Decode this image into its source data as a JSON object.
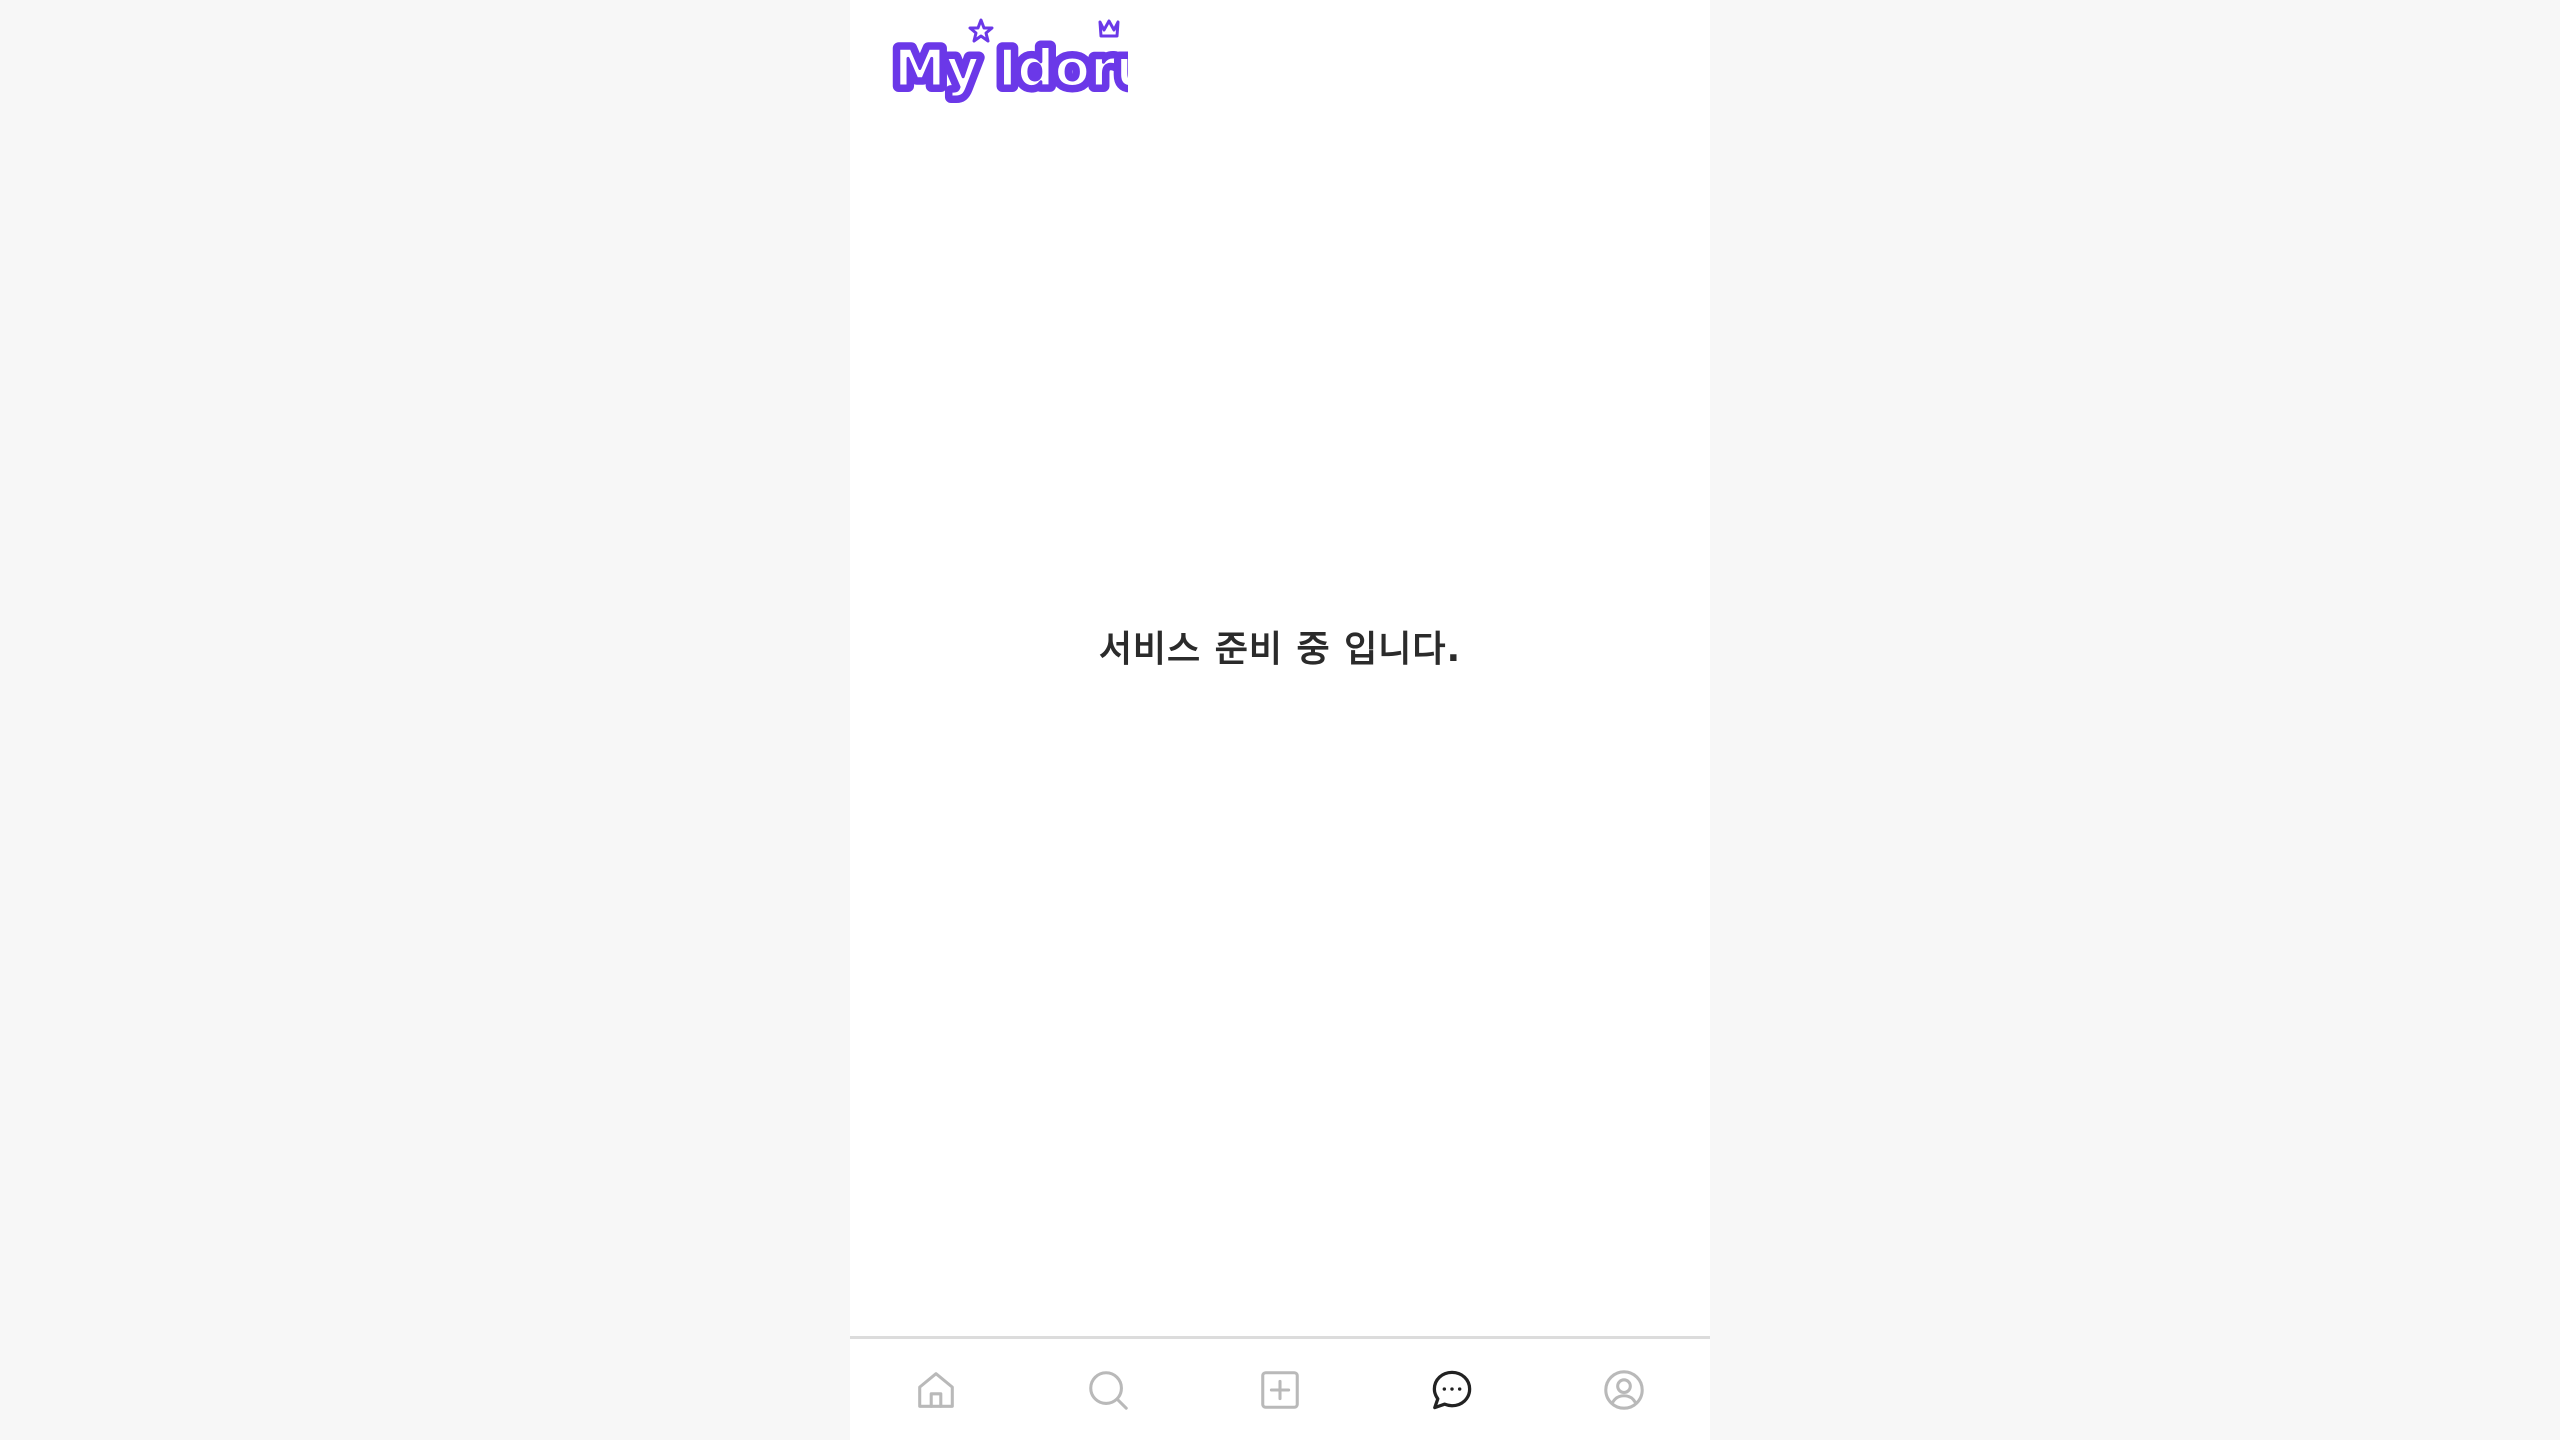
{
  "app": {
    "logo_text": "My Idoru",
    "brand_color": "#6b38e8"
  },
  "main": {
    "notice_text": "서비스 준비 중 입니다."
  },
  "bottom_nav": {
    "active_color": "#222222",
    "inactive_color": "#b9b9b9",
    "items": [
      {
        "icon": "home-icon",
        "active": false
      },
      {
        "icon": "search-icon",
        "active": false
      },
      {
        "icon": "plus-square-icon",
        "active": false
      },
      {
        "icon": "chat-bubble-icon",
        "active": true
      },
      {
        "icon": "user-circle-icon",
        "active": false
      }
    ]
  }
}
